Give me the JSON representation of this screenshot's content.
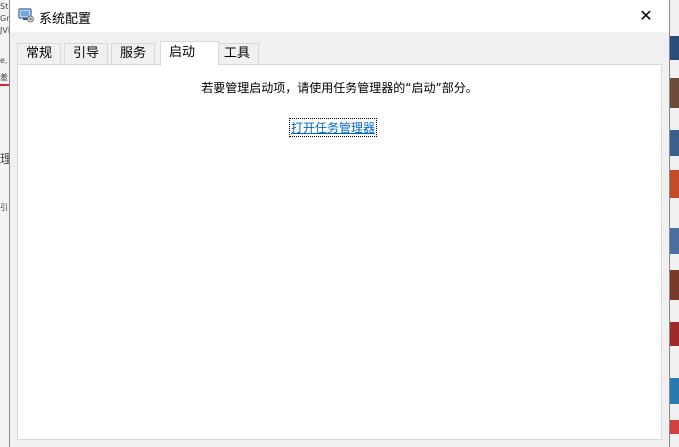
{
  "window": {
    "title": "系统配置",
    "close_symbol": "✕"
  },
  "tabs": [
    {
      "label": "常规",
      "active": false
    },
    {
      "label": "引导",
      "active": false
    },
    {
      "label": "服务",
      "active": false
    },
    {
      "label": "启动",
      "active": true
    },
    {
      "label": "工具",
      "active": false
    }
  ],
  "startup_panel": {
    "message": "若要管理启动项，请使用任务管理器的“启动”部分。",
    "link_label": "打开任务管理器"
  },
  "background_left": {
    "fragments": [
      "St",
      "Gri",
      "JVI",
      "e,",
      "羞",
      "理",
      "引"
    ]
  },
  "colors": {
    "link": "#0066cc",
    "dialog_bg": "#f0f0f0",
    "panel_bg": "#ffffff",
    "accent_red": "#d23333"
  },
  "icons": {
    "app": "system-config-icon",
    "close": "close-icon"
  }
}
